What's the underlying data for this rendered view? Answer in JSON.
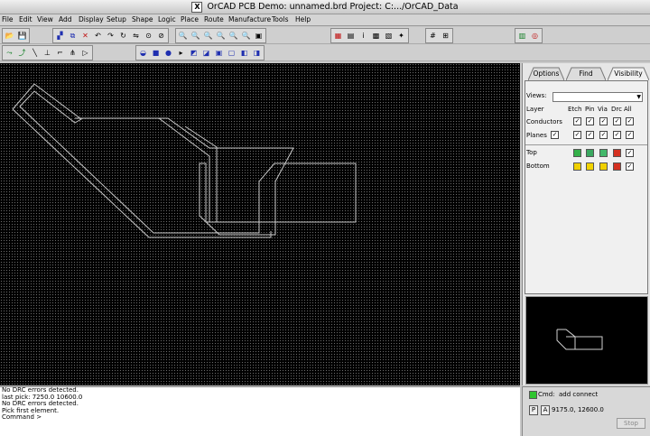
{
  "window": {
    "title": "OrCAD PCB Demo: unnamed.brd  Project: C:.../OrCAD_Data"
  },
  "menu": [
    "File",
    "Edit",
    "View",
    "Add",
    "Display",
    "Setup",
    "Shape",
    "Logic",
    "Place",
    "Route",
    "Manufacture",
    "Tools",
    "Help"
  ],
  "panel": {
    "tabs": [
      "Options",
      "Find",
      "Visibility"
    ],
    "active_tab": "Visibility",
    "viewer_label": "Views:",
    "viewer_value": "",
    "headers": {
      "layer": "Layer",
      "etch": "Etch",
      "pin": "Pin",
      "via": "Via",
      "drc": "Drc",
      "all": "All"
    },
    "rows": [
      {
        "label": "Conductors",
        "checks": [
          true,
          true,
          true,
          true,
          true
        ]
      },
      {
        "label": "Planes",
        "checks": [
          true,
          true,
          true,
          true,
          true,
          true
        ]
      }
    ],
    "layers": [
      {
        "label": "Top",
        "colors": [
          "#34b049",
          "#3aa860",
          "#42b86a",
          "#d43020"
        ],
        "checked": true
      },
      {
        "label": "Bottom",
        "colors": [
          "#f0d000",
          "#f2d400",
          "#f0d000",
          "#d43020"
        ],
        "checked": true
      }
    ]
  },
  "console": {
    "lines": [
      "No DRC errors detected.",
      "last pick:  7250.0  10600.0",
      "No DRC errors detected.",
      "Pick first element.",
      "Command >"
    ]
  },
  "status": {
    "cmd_label": "Cmd:",
    "cmd_value": "add connect",
    "p_label": "P",
    "a_label": "A",
    "coords": "9175.0, 12600.0",
    "stop_label": "Stop",
    "indicator_color": "#2ec42e"
  }
}
